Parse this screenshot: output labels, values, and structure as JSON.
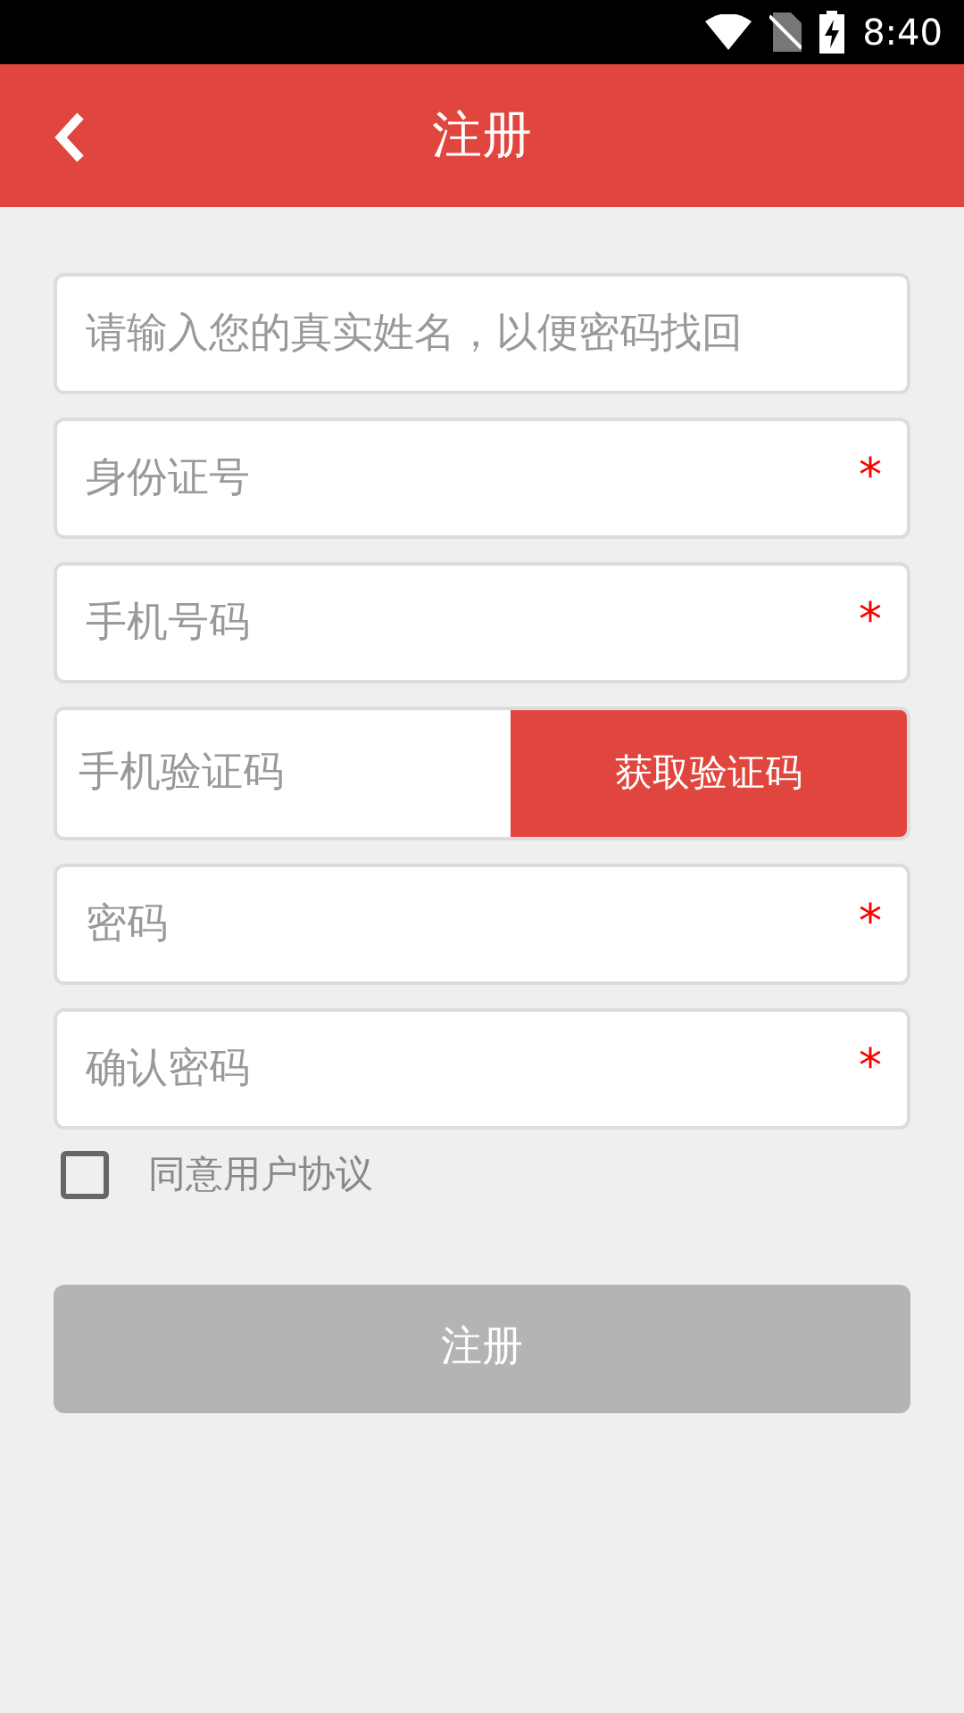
{
  "status_bar": {
    "time": "8:40"
  },
  "header": {
    "title": "注册"
  },
  "fields": [
    {
      "kind": "input",
      "placeholder": "请输入您的真实姓名，以便密码找回"
    },
    {
      "kind": "input",
      "placeholder": "身份证号",
      "required_mark": "*"
    },
    {
      "kind": "input",
      "placeholder": "手机号码",
      "required_mark": "*"
    },
    {
      "kind": "code",
      "placeholder": "手机验证码",
      "button": "获取验证码"
    },
    {
      "kind": "input",
      "placeholder": "密码",
      "required_mark": "*"
    },
    {
      "kind": "input",
      "placeholder": "确认密码",
      "required_mark": "*"
    }
  ],
  "agreement": {
    "label": "同意用户协议",
    "checked": false
  },
  "submit": {
    "label": "注册",
    "disabled": true
  }
}
